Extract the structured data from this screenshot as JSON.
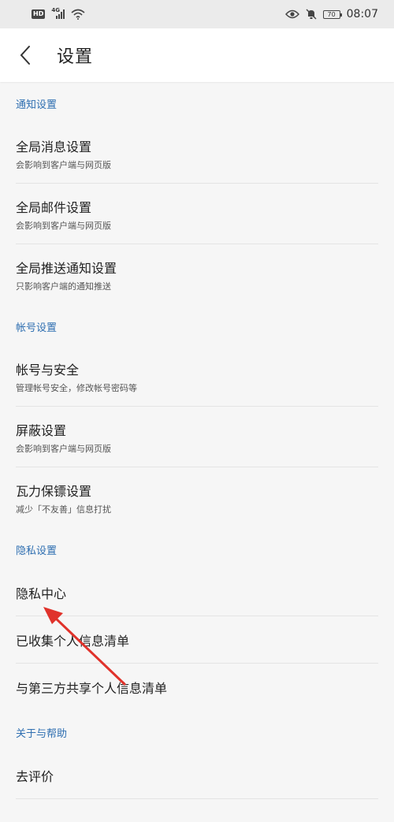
{
  "status_bar": {
    "hd": "HD",
    "network": "4G",
    "battery": "70",
    "time": "08:07"
  },
  "header": {
    "title": "设置"
  },
  "sections": [
    {
      "title": "通知设置",
      "items": [
        {
          "title": "全局消息设置",
          "subtitle": "会影响到客户端与网页版"
        },
        {
          "title": "全局邮件设置",
          "subtitle": "会影响到客户端与网页版"
        },
        {
          "title": "全局推送通知设置",
          "subtitle": "只影响客户端的通知推送"
        }
      ]
    },
    {
      "title": "帐号设置",
      "items": [
        {
          "title": "帐号与安全",
          "subtitle": "管理帐号安全，修改帐号密码等"
        },
        {
          "title": "屏蔽设置",
          "subtitle": "会影响到客户端与网页版"
        },
        {
          "title": "瓦力保镖设置",
          "subtitle": "减少「不友善」信息打扰"
        }
      ]
    },
    {
      "title": "隐私设置",
      "items": [
        {
          "title": "隐私中心"
        },
        {
          "title": "已收集个人信息清单"
        },
        {
          "title": "与第三方共享个人信息清单"
        }
      ]
    },
    {
      "title": "关于与帮助",
      "items": [
        {
          "title": "去评价"
        }
      ]
    }
  ],
  "colors": {
    "section_title": "#2f6fb1",
    "arrow": "#e0322b"
  }
}
